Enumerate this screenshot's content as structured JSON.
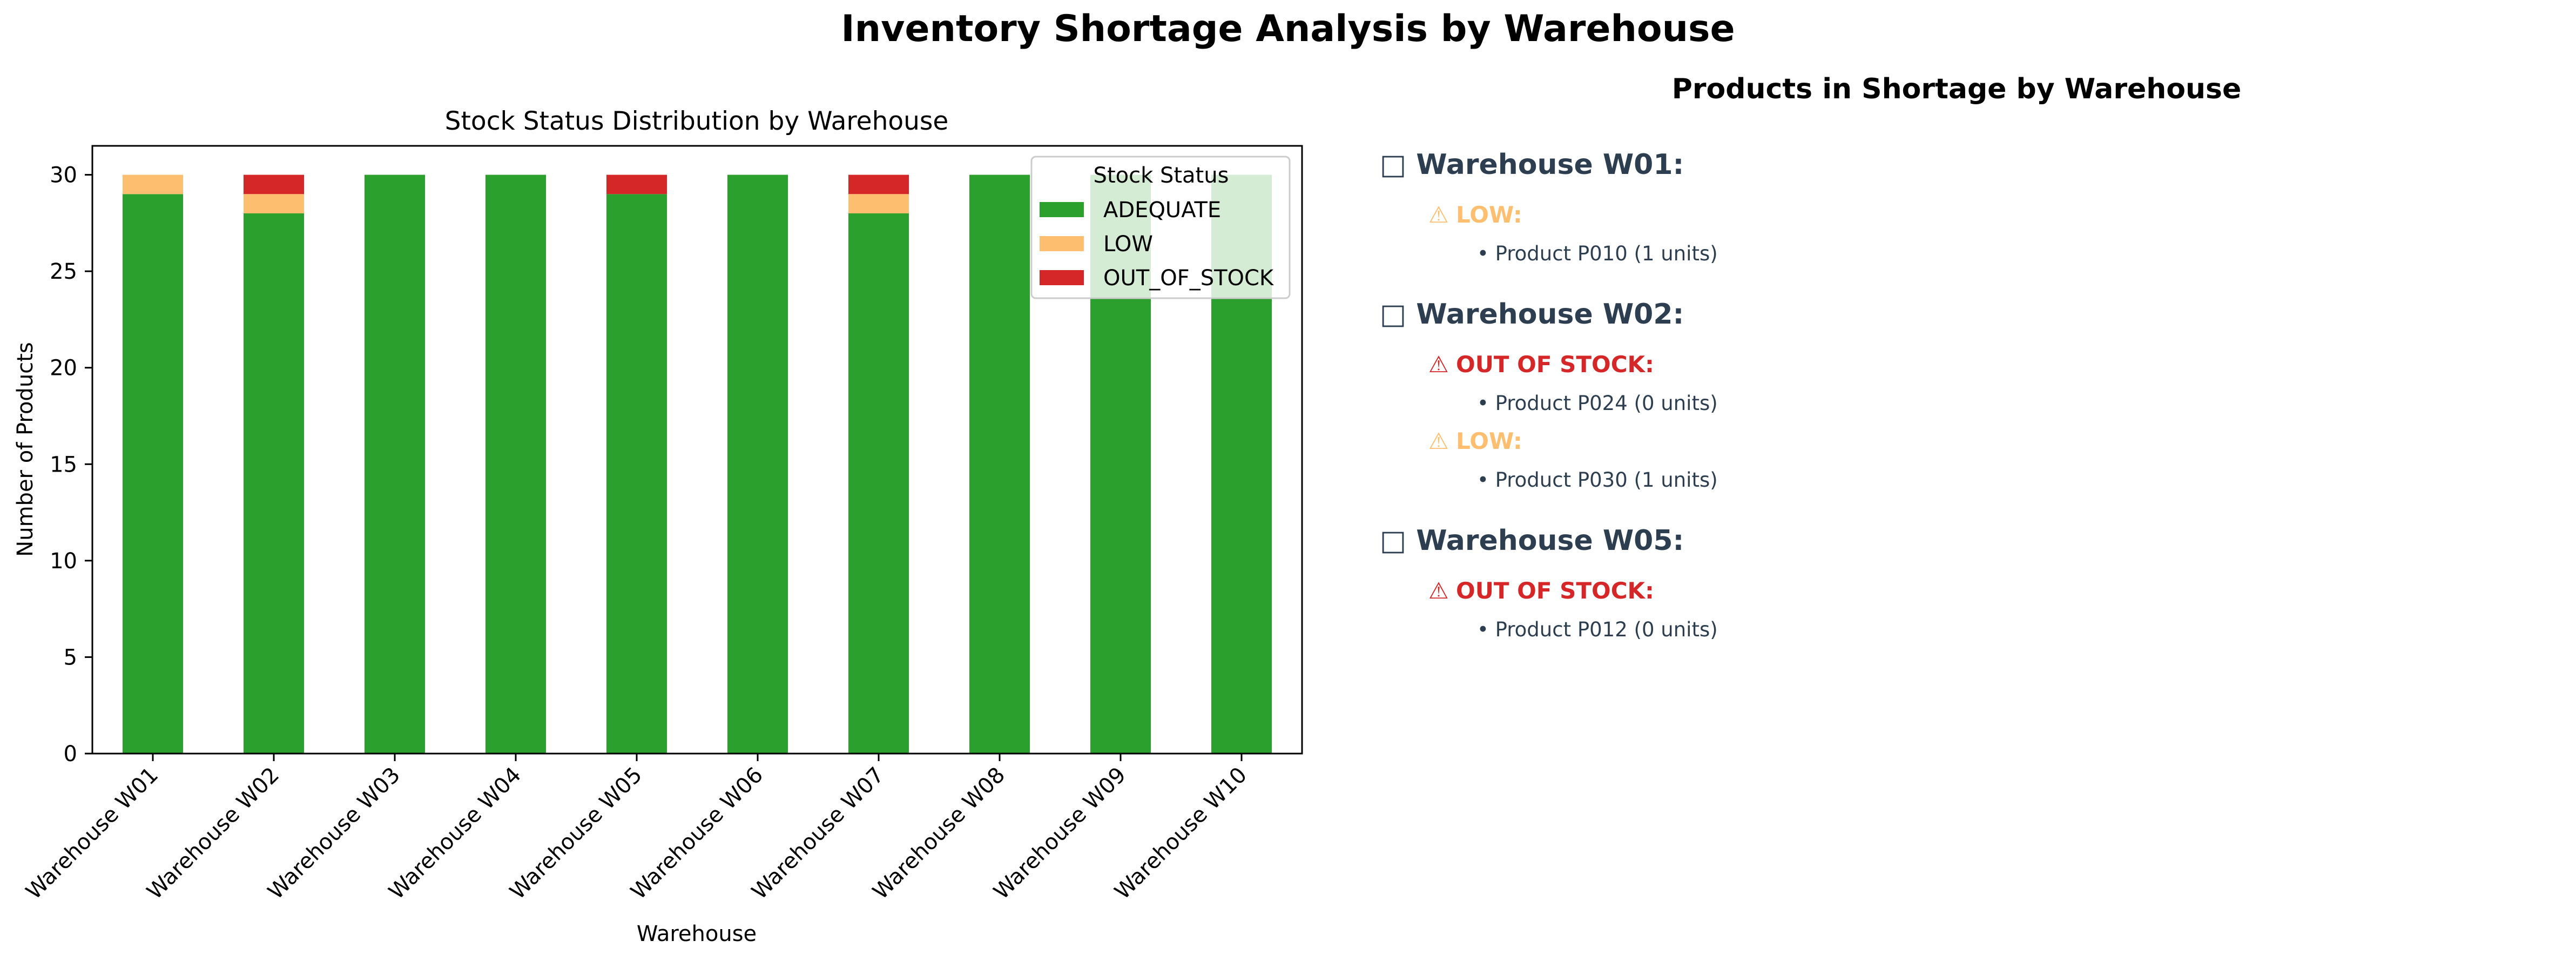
{
  "figure": {
    "title": "Inventory Shortage Analysis by Warehouse"
  },
  "chart_data": {
    "type": "bar",
    "stacked": true,
    "title": "Stock Status Distribution by Warehouse",
    "xlabel": "Warehouse",
    "ylabel": "Number of Products",
    "ylim": [
      0,
      31.5
    ],
    "yticks": [
      0,
      5,
      10,
      15,
      20,
      25,
      30
    ],
    "grid": false,
    "categories": [
      "Warehouse W01",
      "Warehouse W02",
      "Warehouse W03",
      "Warehouse W04",
      "Warehouse W05",
      "Warehouse W06",
      "Warehouse W07",
      "Warehouse W08",
      "Warehouse W09",
      "Warehouse W10"
    ],
    "series": [
      {
        "name": "ADEQUATE",
        "color": "#2ca02c",
        "values": [
          29,
          28,
          30,
          30,
          29,
          30,
          28,
          30,
          30,
          30
        ]
      },
      {
        "name": "LOW",
        "color": "#fdbf6f",
        "values": [
          1,
          1,
          0,
          0,
          0,
          0,
          1,
          0,
          0,
          0
        ]
      },
      {
        "name": "OUT_OF_STOCK",
        "color": "#d62728",
        "values": [
          0,
          1,
          0,
          0,
          1,
          0,
          1,
          0,
          0,
          0
        ]
      }
    ],
    "legend": {
      "title": "Stock Status",
      "position": "top-right"
    }
  },
  "shortage_panel": {
    "title": "Products in Shortage by Warehouse",
    "warehouse_icon": "package-icon",
    "status_icon": "warning-icon",
    "text_color": "#2c3e50",
    "groups": [
      {
        "warehouse": "Warehouse W01:",
        "statuses": [
          {
            "label": "LOW:",
            "color": "#fdbf6f",
            "items": [
              "• Product P010 (1 units)"
            ]
          }
        ]
      },
      {
        "warehouse": "Warehouse W02:",
        "statuses": [
          {
            "label": "OUT OF STOCK:",
            "color": "#d62728",
            "items": [
              "• Product P024 (0 units)"
            ]
          },
          {
            "label": "LOW:",
            "color": "#fdbf6f",
            "items": [
              "• Product P030 (1 units)"
            ]
          }
        ]
      },
      {
        "warehouse": "Warehouse W05:",
        "statuses": [
          {
            "label": "OUT OF STOCK:",
            "color": "#d62728",
            "items": [
              "• Product P012 (0 units)"
            ]
          }
        ]
      }
    ]
  }
}
